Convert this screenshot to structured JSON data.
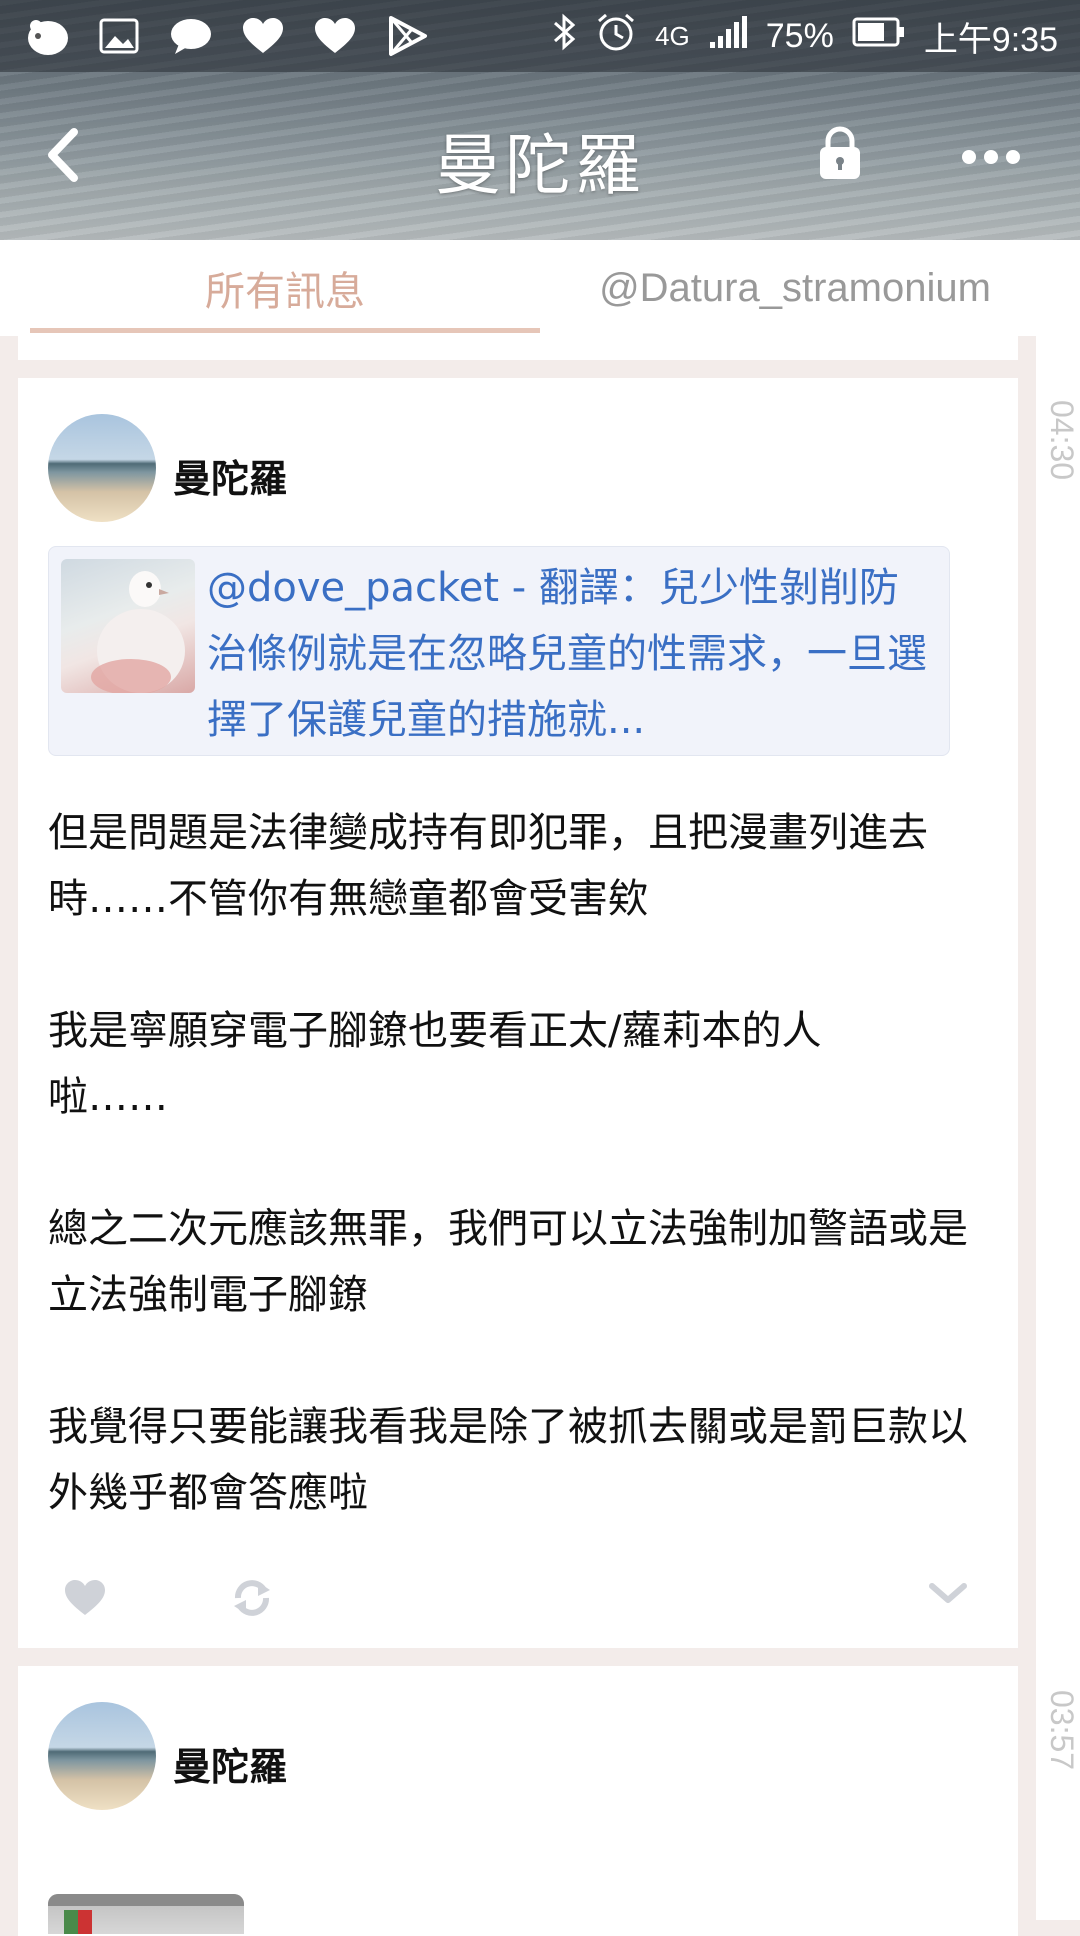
{
  "status_bar": {
    "battery": "75%",
    "time": "上午9:35",
    "network": "4G",
    "left_icons": [
      "notification-icon",
      "gallery-icon",
      "chat-icon",
      "heart-icon",
      "heart-icon",
      "play-store-icon"
    ],
    "right_icons": [
      "bluetooth-icon",
      "alarm-icon",
      "signal-icon",
      "battery-icon"
    ]
  },
  "header": {
    "title": "曼陀羅"
  },
  "tabs": [
    {
      "label": "所有訊息",
      "active": true
    },
    {
      "label": "@Datura_stramonium",
      "active": false
    }
  ],
  "posts": [
    {
      "time": "04:30",
      "author": "曼陀羅",
      "quote": "@dove_packet - 翻譯：兒少性剝削防治條例就是在忽略兒童的性需求，一旦選擇了保護兒童的措施就...",
      "paragraphs": [
        "但是問題是法律變成持有即犯罪，且把漫畫列進去時……不管你有無戀童都會受害欸",
        "我是寧願穿電子腳鐐也要看正太/蘿莉本的人啦……",
        "總之二次元應該無罪，我們可以立法強制加警語或是立法強制電子腳鐐",
        "我覺得只要能讓我看我是除了被抓去關或是罰巨款以外幾乎都會答應啦"
      ]
    },
    {
      "time": "03:57",
      "author": "曼陀羅"
    }
  ],
  "colors": {
    "accent": "#d7ab9a",
    "link": "#3a6fc4",
    "background": "#f3ecea"
  }
}
